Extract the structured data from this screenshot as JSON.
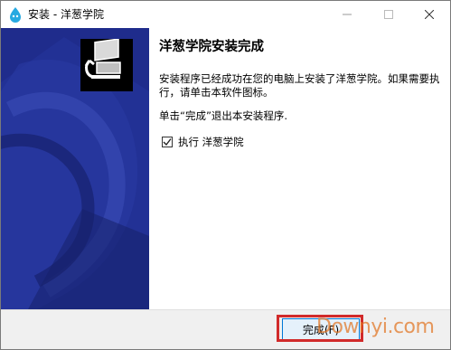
{
  "window": {
    "title": "安装 - 洋葱学院"
  },
  "content": {
    "heading": "洋葱学院安装完成",
    "paragraph1": "安装程序已经成功在您的电脑上安装了洋葱学院。如果需要执行，请单击本软件图标。",
    "paragraph2": "单击“完成”退出本安装程序.",
    "checkbox_label": "执行 洋葱学院",
    "checkbox_checked": true
  },
  "buttons": {
    "finish_label": "完成(F)"
  },
  "watermark": {
    "text": "Downyi.com"
  },
  "colors": {
    "side_panel": "#1e2d8e",
    "highlight": "#d12a2a",
    "accent": "#0078d7"
  },
  "icons": {
    "app": "onion-droplet-icon",
    "minimize": "minimize-icon",
    "maximize": "maximize-icon",
    "close": "close-icon",
    "installer": "computer-install-icon",
    "check": "checkmark-icon"
  }
}
